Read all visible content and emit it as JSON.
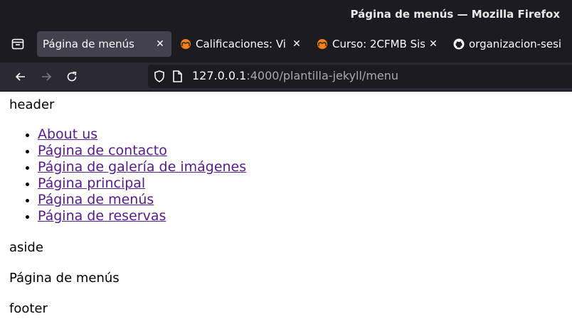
{
  "window": {
    "title": "Página de menús — Mozilla Firefox"
  },
  "tabs": [
    {
      "label": "Página de menús",
      "active": true,
      "icon": "none"
    },
    {
      "label": "Calificaciones: Vi",
      "active": false,
      "icon": "moodle-icon"
    },
    {
      "label": "Curso: 2CFMB Sis",
      "active": false,
      "icon": "moodle-icon"
    },
    {
      "label": "organizacion-sesi",
      "active": false,
      "icon": "github-icon"
    }
  ],
  "navbar": {
    "url_host": "127.0.0.1",
    "url_rest": ":4000/plantilla-jekyll/menu"
  },
  "page": {
    "header": "header",
    "nav_links": [
      "About us",
      "Página de contacto",
      "Página de galería de imágenes",
      "Página principal",
      "Página de menús",
      "Página de reservas"
    ],
    "aside": "aside",
    "main": "Página de menús",
    "footer": "footer"
  }
}
